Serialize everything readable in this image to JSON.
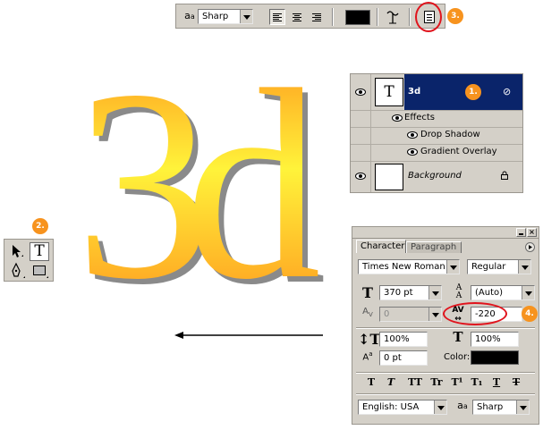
{
  "options_bar": {
    "aa_icon": "anti-alias-icon",
    "antialias_value": "Sharp",
    "align": [
      "align-left-icon",
      "align-center-icon",
      "align-right-icon"
    ],
    "color_hex": "#000000",
    "warp_icon": "warp-text-icon",
    "palettes_icon": "toggle-palettes-icon",
    "step_badge": "3."
  },
  "artwork": {
    "text": "3d",
    "gradient_top": "#ff8c1a",
    "gradient_mid": "#fff33a",
    "gradient_bottom": "#ff8c1a",
    "shadow_color": "#8a8a8a"
  },
  "layers_panel": {
    "text_layer_name": "3d",
    "text_layer_thumb": "T",
    "step_badge": "1.",
    "effects_label": "Effects",
    "drop_shadow_label": "Drop Shadow",
    "gradient_overlay_label": "Gradient Overlay",
    "background_label": "Background",
    "selected_color": "#0a246a"
  },
  "tools_panel": {
    "step_badge": "2.",
    "tools": [
      "move-tool-icon",
      "type-tool-icon",
      "pen-tool-icon",
      "rectangle-tool-icon"
    ]
  },
  "character_panel": {
    "tab_character": "Character",
    "tab_paragraph": "Paragraph",
    "font_family": "Times New Roman",
    "font_style": "Regular",
    "font_size": "370 pt",
    "leading": "(Auto)",
    "kerning": "0",
    "tracking": "-220",
    "vertical_scale": "100%",
    "horizontal_scale": "100%",
    "baseline_shift": "0 pt",
    "color_label": "Color:",
    "color_hex": "#000000",
    "style_buttons": [
      "T",
      "T",
      "TT",
      "Tr",
      "T¹",
      "T₁",
      "T",
      "T"
    ],
    "language": "English: USA",
    "aa_icon": "anti-alias-icon",
    "antialias": "Sharp",
    "step_badge": "4."
  }
}
